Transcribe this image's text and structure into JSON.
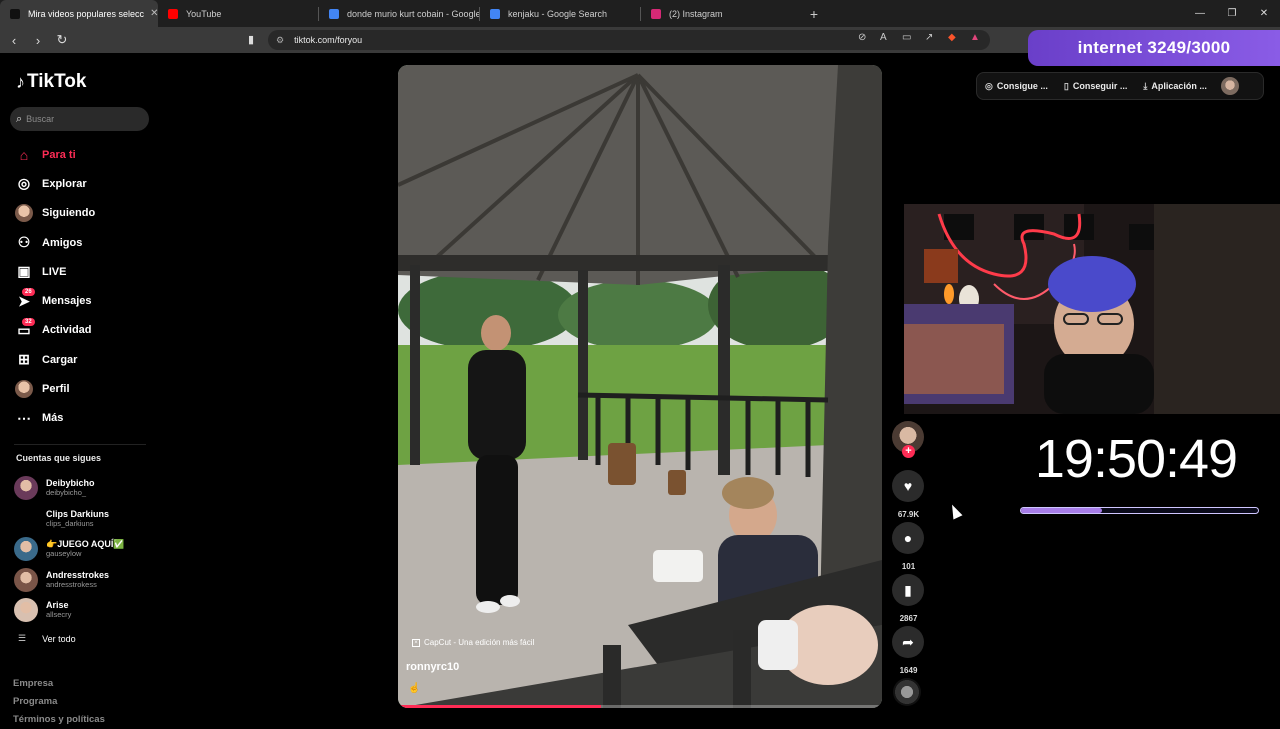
{
  "browser": {
    "tabs": [
      {
        "title": "Mira videos populares selecc",
        "active": true,
        "favicon_color": "#111111"
      },
      {
        "title": "YouTube",
        "active": false,
        "favicon_color": "#ff0000"
      },
      {
        "title": "donde murio kurt cobain - Google Se",
        "active": false,
        "favicon_color": "#4285f4"
      },
      {
        "title": "kenjaku - Google Search",
        "active": false,
        "favicon_color": "#4285f4"
      },
      {
        "title": "(2) Instagram",
        "active": false,
        "favicon_color": "#d62976"
      }
    ],
    "new_tab_label": "+",
    "url": "tiktok.com/foryou",
    "window_controls": [
      "—",
      "❐",
      "✕"
    ]
  },
  "overlay": {
    "internet_label": "internet 3249/3000"
  },
  "sidebar": {
    "logo_text": "TikTok",
    "search_placeholder": "Buscar",
    "nav": [
      {
        "label": "Para ti",
        "icon": "home-icon",
        "active": true
      },
      {
        "label": "Explorar",
        "icon": "compass-icon"
      },
      {
        "label": "Siguiendo",
        "icon": "following-avatar-icon"
      },
      {
        "label": "Amigos",
        "icon": "friends-icon"
      },
      {
        "label": "LIVE",
        "icon": "live-icon"
      },
      {
        "label": "Mensajes",
        "icon": "messages-icon",
        "badge": "26"
      },
      {
        "label": "Actividad",
        "icon": "activity-icon",
        "badge": "32"
      },
      {
        "label": "Cargar",
        "icon": "upload-icon"
      },
      {
        "label": "Perfil",
        "icon": "profile-icon"
      },
      {
        "label": "Más",
        "icon": "more-icon"
      }
    ],
    "following_header": "Cuentas que sigues",
    "following": [
      {
        "name": "Deibybicho",
        "handle": "deibybicho_",
        "avatar_color": "#6a3a5a"
      },
      {
        "name": "Clips Darkiuns",
        "handle": "clips_darkiuns",
        "avatar_color": ""
      },
      {
        "name": "👉JUEGO AQUÍ✅",
        "handle": "gauseylow",
        "avatar_color": "#3a6a8a"
      },
      {
        "name": "Andresstrokes",
        "handle": "andresstrokess",
        "avatar_color": "#7a5548"
      },
      {
        "name": "Arise",
        "handle": "allsecry",
        "avatar_color": "#d8c0b0"
      }
    ],
    "see_all": "Ver todo",
    "footer": [
      "Empresa",
      "Programa",
      "Términos y políticas"
    ]
  },
  "video": {
    "watermark": "CapCut - Una edición más fácil",
    "username": "ronnyrc10",
    "progress": 0.42
  },
  "actions": {
    "likes": "67.9K",
    "comments": "101",
    "saves": "2867",
    "shares": "1649"
  },
  "topbar": {
    "buttons": [
      "Consigue ...",
      "Conseguir ...",
      "Aplicación ..."
    ]
  },
  "stream": {
    "timer": "19:50:49",
    "timer_progress": 0.34
  }
}
